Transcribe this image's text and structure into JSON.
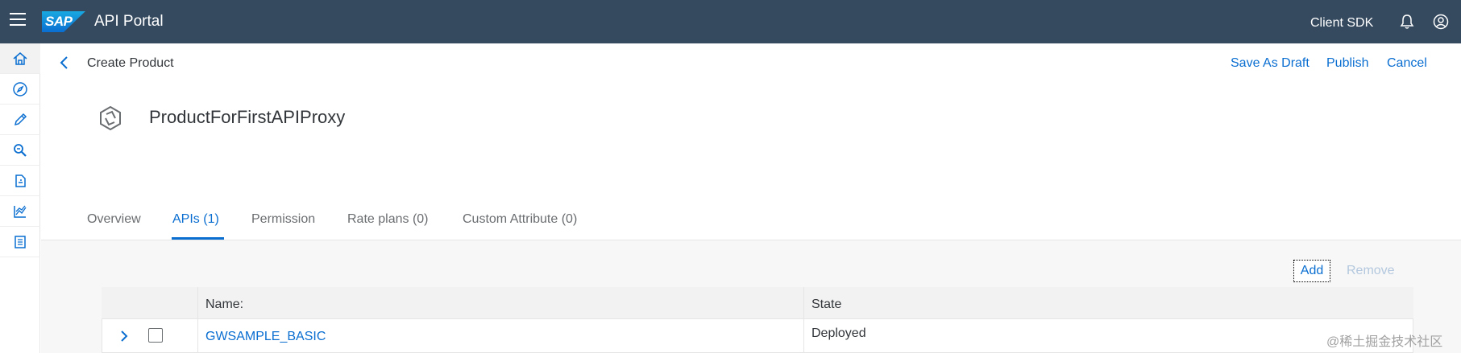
{
  "shell": {
    "logo": "SAP",
    "title": "API Portal",
    "client_sdk": "Client SDK"
  },
  "sidenav": {
    "items": [
      {
        "name": "home-icon",
        "active": true
      },
      {
        "name": "discover-icon"
      },
      {
        "name": "develop-icon"
      },
      {
        "name": "test-icon"
      },
      {
        "name": "publish-icon"
      },
      {
        "name": "analyze-icon"
      },
      {
        "name": "monitor-icon"
      }
    ]
  },
  "header": {
    "breadcrumb": "Create Product",
    "actions": {
      "save_draft": "Save As Draft",
      "publish": "Publish",
      "cancel": "Cancel"
    },
    "title": "ProductForFirstAPIProxy"
  },
  "tabs": [
    {
      "label": "Overview",
      "active": false
    },
    {
      "label": "APIs (1)",
      "active": true
    },
    {
      "label": "Permission",
      "active": false
    },
    {
      "label": "Rate plans (0)",
      "active": false
    },
    {
      "label": "Custom Attribute (0)",
      "active": false
    }
  ],
  "toolbar": {
    "add": "Add",
    "remove": "Remove"
  },
  "table": {
    "headers": {
      "name": "Name:",
      "state": "State"
    },
    "rows": [
      {
        "name": "GWSAMPLE_BASIC",
        "state": "Deployed"
      }
    ]
  },
  "watermark": "@稀土掘金技术社区",
  "colors": {
    "shell": "#354a5f",
    "accent": "#0a6ed1"
  }
}
